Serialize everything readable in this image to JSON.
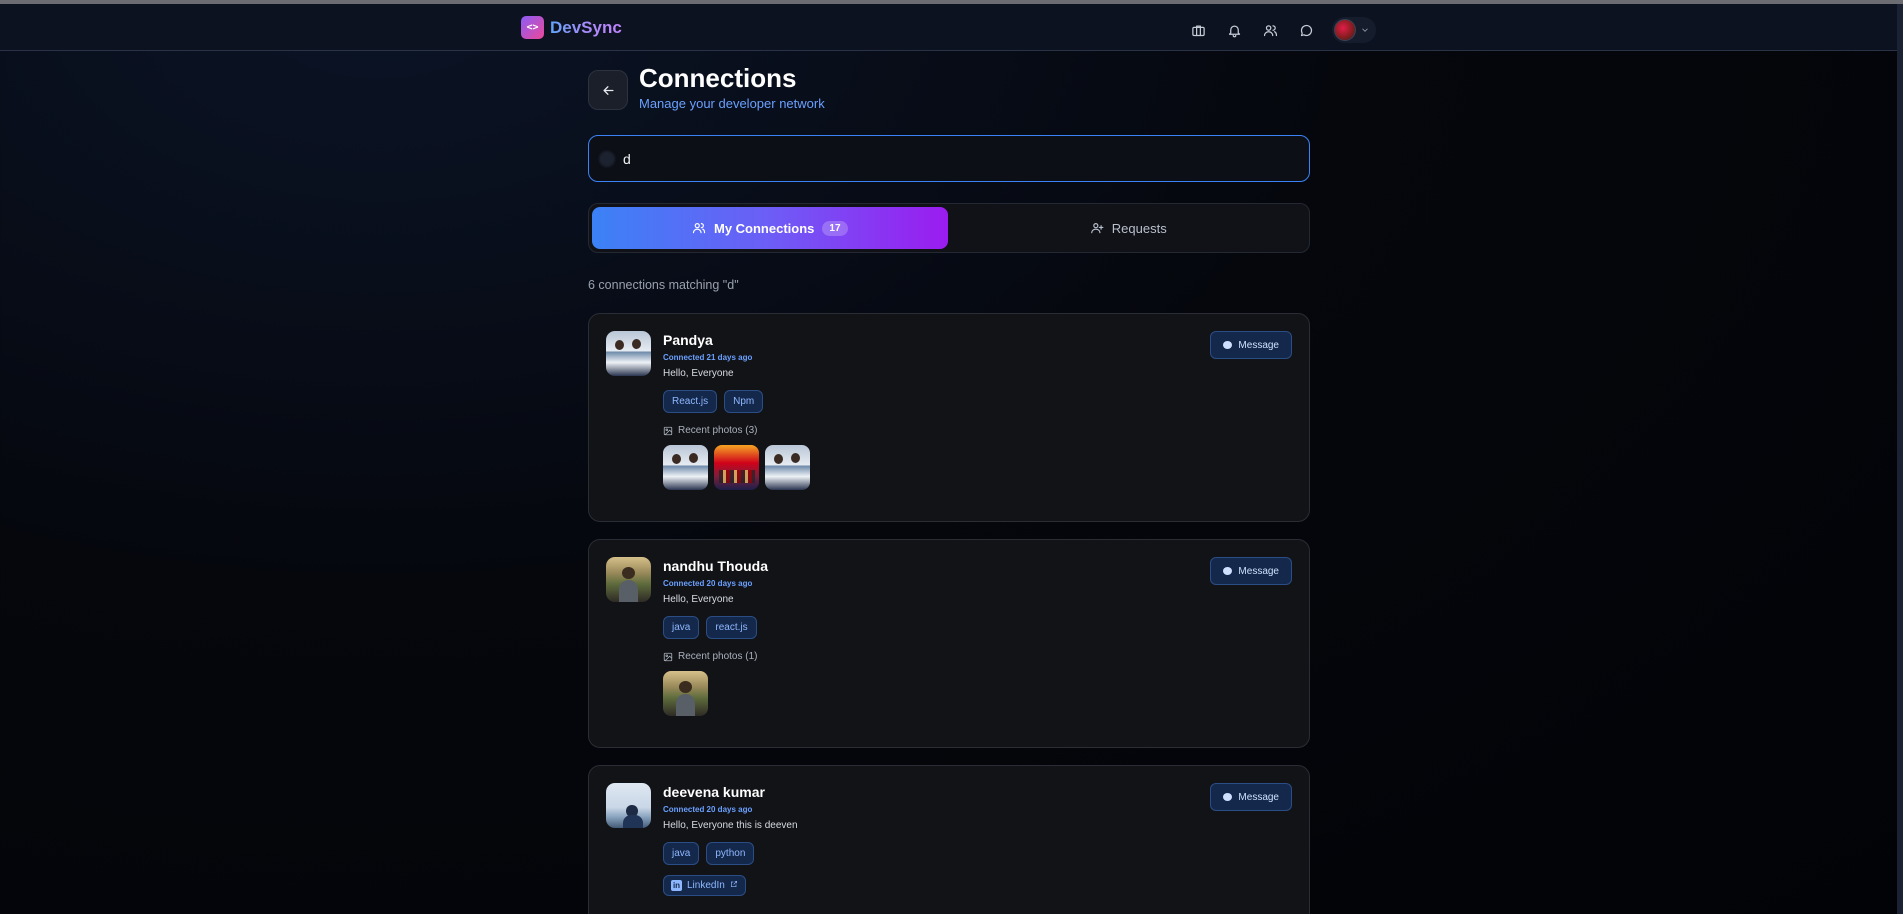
{
  "app": {
    "name": "DevSync",
    "logo_glyph": "<>"
  },
  "nav": {
    "icons": [
      "briefcase-icon",
      "bell-icon",
      "users-icon",
      "chat-icon"
    ]
  },
  "header": {
    "title": "Connections",
    "subtitle": "Manage your developer network"
  },
  "search": {
    "value": "d"
  },
  "tabs": {
    "my_connections": {
      "label": "My Connections",
      "count": "17"
    },
    "requests": {
      "label": "Requests"
    }
  },
  "results_text": "6 connections matching \"d\"",
  "message_label": "Message",
  "connections": [
    {
      "name": "Pandya",
      "connected": "Connected 21 days ago",
      "bio": "Hello, Everyone",
      "tags": [
        "React.js",
        "Npm"
      ],
      "photos_label": "Recent photos (3)"
    },
    {
      "name": "nandhu Thouda",
      "connected": "Connected 20 days ago",
      "bio": "Hello, Everyone",
      "tags": [
        "java",
        "react.js"
      ],
      "photos_label": "Recent photos (1)"
    },
    {
      "name": "deevena kumar",
      "connected": "Connected 20 days ago",
      "bio": "Hello, Everyone this is deeven",
      "tags": [
        "java",
        "python"
      ],
      "linkedin_label": "LinkedIn"
    }
  ],
  "colors": {
    "accent": "#3b82f6",
    "tab_gradient_end": "#9b1cf0",
    "link": "#6aa0ff"
  }
}
